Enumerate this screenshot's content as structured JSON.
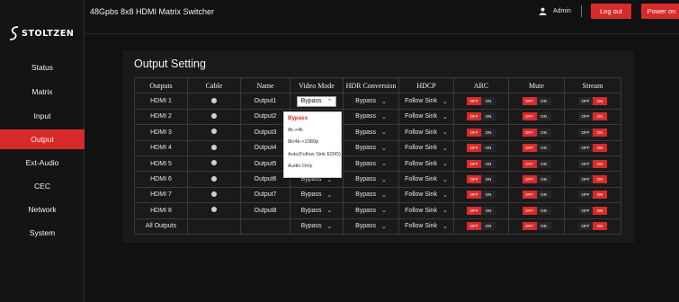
{
  "brand": {
    "name": "STOLTZEN",
    "accent": "#d72b2b"
  },
  "sidebar": {
    "items": [
      {
        "label": "Status",
        "active": false
      },
      {
        "label": "Matrix",
        "active": false
      },
      {
        "label": "Input",
        "active": false
      },
      {
        "label": "Output",
        "active": true
      },
      {
        "label": "Ext-Audio",
        "active": false
      },
      {
        "label": "CEC",
        "active": false
      },
      {
        "label": "Network",
        "active": false
      },
      {
        "label": "System",
        "active": false
      }
    ]
  },
  "header": {
    "title": "48Gpbs 8x8 HDMI Matrix Switcher",
    "user": "Admin",
    "user_icon": "user-icon",
    "logout_label": "Log out",
    "poweron_label": "Power on"
  },
  "panel": {
    "title": "Output Setting",
    "columns": [
      "Outputs",
      "Cable",
      "Name",
      "Video Mode",
      "HDR Conversion",
      "HDCP",
      "ARC",
      "Mute",
      "Stream"
    ],
    "rows": [
      {
        "output": "HDMI 1",
        "cable": true,
        "name": "Output1",
        "video_mode": "Bypass",
        "hdr": "Bypass",
        "hdcp": "Follow Sink",
        "arc": "OFF",
        "mute": "OFF",
        "stream": "ON"
      },
      {
        "output": "HDMI 2",
        "cable": true,
        "name": "Output2",
        "video_mode": "Bypass",
        "hdr": "Bypass",
        "hdcp": "Follow Sink",
        "arc": "OFF",
        "mute": "OFF",
        "stream": "ON"
      },
      {
        "output": "HDMI 3",
        "cable": true,
        "name": "Output3",
        "video_mode": "Bypass",
        "hdr": "Bypass",
        "hdcp": "Follow Sink",
        "arc": "OFF",
        "mute": "OFF",
        "stream": "ON"
      },
      {
        "output": "HDMI 4",
        "cable": true,
        "name": "Output4",
        "video_mode": "Bypass",
        "hdr": "Bypass",
        "hdcp": "Follow Sink",
        "arc": "OFF",
        "mute": "OFF",
        "stream": "ON"
      },
      {
        "output": "HDMI 5",
        "cable": true,
        "name": "Output5",
        "video_mode": "Bypass",
        "hdr": "Bypass",
        "hdcp": "Follow Sink",
        "arc": "OFF",
        "mute": "OFF",
        "stream": "ON"
      },
      {
        "output": "HDMI 6",
        "cable": true,
        "name": "Output6",
        "video_mode": "Bypass",
        "hdr": "Bypass",
        "hdcp": "Follow Sink",
        "arc": "OFF",
        "mute": "OFF",
        "stream": "ON"
      },
      {
        "output": "HDMI 7",
        "cable": true,
        "name": "Output7",
        "video_mode": "Bypass",
        "hdr": "Bypass",
        "hdcp": "Follow Sink",
        "arc": "OFF",
        "mute": "OFF",
        "stream": "ON"
      },
      {
        "output": "HDMI 8",
        "cable": true,
        "name": "Output8",
        "video_mode": "Bypass",
        "hdr": "Bypass",
        "hdcp": "Follow Sink",
        "arc": "OFF",
        "mute": "OFF",
        "stream": "ON"
      }
    ],
    "all_row": {
      "output": "All Outputs",
      "video_mode": "Bypass",
      "hdr": "Bypass",
      "hdcp": "Follow Sink",
      "arc": "OFF",
      "mute": "OFF",
      "stream": "ON"
    },
    "toggle_labels": {
      "off": "OFF",
      "on": "ON"
    },
    "video_mode_dropdown": {
      "open_on_row": "HDMI 1",
      "options": [
        "Bypass",
        "8k->4k",
        "8k/4k->1080p",
        "Auto(Follow Sink EDID)",
        "Audio Only"
      ],
      "selected": "Bypass"
    }
  }
}
